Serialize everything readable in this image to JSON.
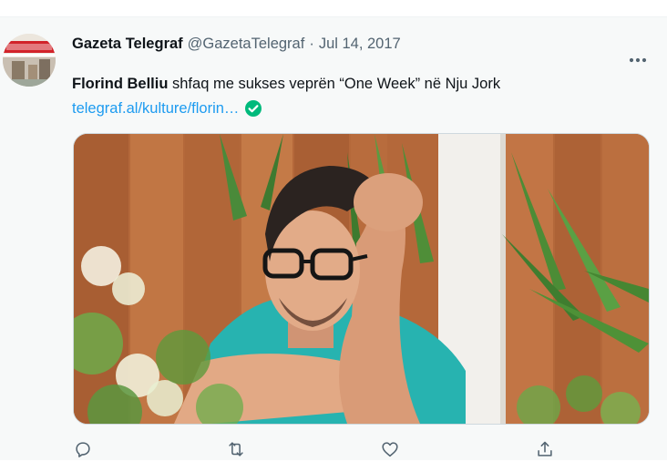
{
  "tweet": {
    "author_name": "Gazeta Telegraf",
    "author_handle": "@GazetaTelegraf",
    "separator": "·",
    "date": "Jul 14, 2017",
    "text_mention": "Florind Belliu",
    "text_body": " shfaq me sukses veprën “One Week” në Nju Jork",
    "link_text": "telegraf.al/kulture/florin…"
  },
  "icons": {
    "more": "more-horizontal-icon",
    "verified": "check-circle-icon",
    "reply": "reply-icon",
    "retweet": "retweet-icon",
    "like": "heart-icon",
    "share": "share-icon"
  },
  "colors": {
    "accent": "#1d9bf0",
    "verified": "#00ba7c",
    "muted": "#536471",
    "tweet_background": "#f7f9f9"
  }
}
